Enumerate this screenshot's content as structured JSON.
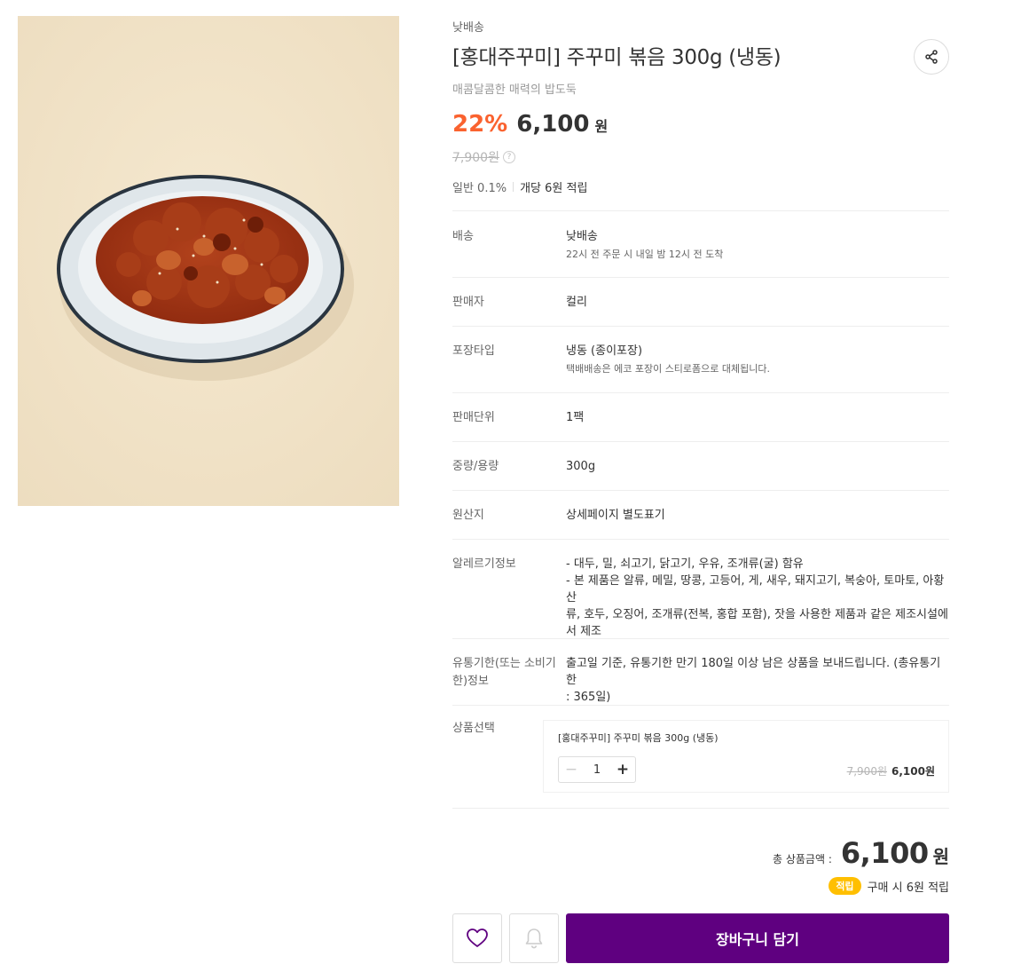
{
  "product": {
    "delivery_tag": "낮배송",
    "title": "[홍대주꾸미] 주꾸미 볶음 300g (냉동)",
    "subtitle": "매콤달콤한 매력의 밥도둑",
    "discount": "22%",
    "price": "6,100",
    "currency": "원",
    "original_price": "7,900원",
    "points_level": "일반 0.1%",
    "points_text": "개당 6원 적립",
    "share_icon": "share-icon",
    "help_icon": "?"
  },
  "specs": [
    {
      "label": "배송",
      "value": "낮배송",
      "sub": "22시 전 주문 시 내일 밤 12시 전 도착"
    },
    {
      "label": "판매자",
      "value": "컬리"
    },
    {
      "label": "포장타입",
      "value": "냉동 (종이포장)",
      "sub": "택배배송은 에코 포장이 스티로폼으로 대체됩니다."
    },
    {
      "label": "판매단위",
      "value": "1팩"
    },
    {
      "label": "중량/용량",
      "value": "300g"
    },
    {
      "label": "원산지",
      "value": "상세페이지 별도표기"
    },
    {
      "label": "알레르기정보",
      "value_lines": [
        "- 대두, 밀, 쇠고기, 닭고기, 우유, 조개류(굴) 함유",
        "- 본 제품은 알류, 메밀, 땅콩, 고등어, 게, 새우, 돼지고기, 복숭아, 토마토, 아황산",
        "류, 호두, 오징어, 조개류(전복, 홍합 포함), 잣을 사용한 제품과 같은 제조시설에",
        "서 제조"
      ]
    },
    {
      "label_lines": [
        "유통기한(또는 소비기",
        "한)정보"
      ],
      "value_lines": [
        "출고일 기준, 유통기한 만기 180일 이상 남은 상품을 보내드립니다. (총유통기한",
        ": 365일)"
      ]
    }
  ],
  "option": {
    "label": "상품선택",
    "name": "[홍대주꾸미] 주꾸미 볶음 300g (냉동)",
    "minus": "−",
    "plus": "+",
    "quantity": "1",
    "original_price": "7,900원",
    "sale_price": "6,100원"
  },
  "total": {
    "label": "총 상품금액 :",
    "amount": "6,100",
    "currency": "원",
    "earn_badge": "적립",
    "earn_text": "구매 시 6원 적립"
  },
  "actions": {
    "wish_icon": "heart-icon",
    "alert_icon": "bell-icon",
    "cart_label": "장바구니 담기"
  },
  "colors": {
    "brand": "#5f0080",
    "discount": "#fa622f",
    "earn_badge": "#ffbf00"
  }
}
